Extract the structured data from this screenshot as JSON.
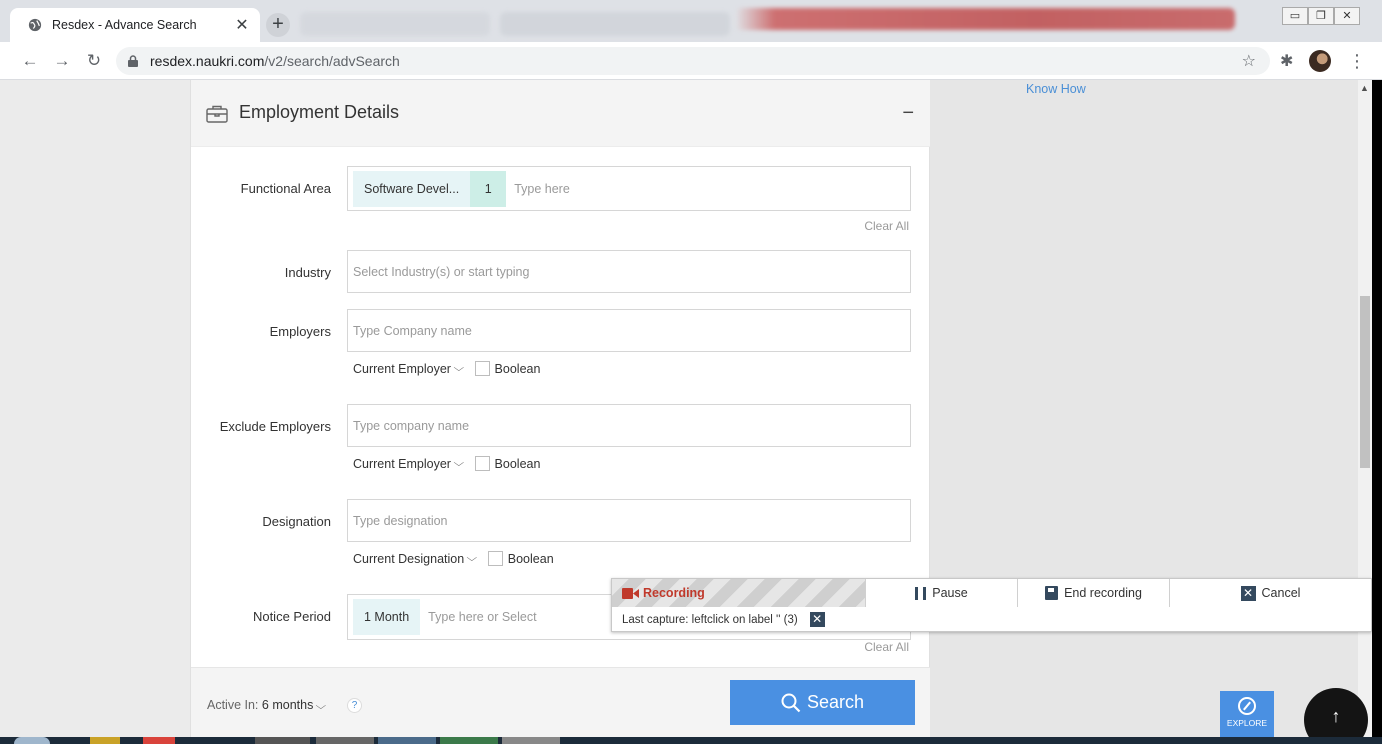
{
  "browser": {
    "tab_title": "Resdex - Advance Search",
    "url_host": "resdex.naukri.com",
    "url_path": "/v2/search/advSearch"
  },
  "side": {
    "know_how": "Know How"
  },
  "section": {
    "title": "Employment Details",
    "collapse_symbol": "−"
  },
  "functional_area": {
    "label": "Functional Area",
    "chip": "Software Devel...",
    "count": "1",
    "placeholder": "Type here",
    "clear": "Clear All"
  },
  "industry": {
    "label": "Industry",
    "placeholder": "Select Industry(s) or start typing"
  },
  "employers": {
    "label": "Employers",
    "placeholder": "Type Company name",
    "scope": "Current Employer",
    "boolean": "Boolean"
  },
  "exclude_employers": {
    "label": "Exclude Employers",
    "placeholder": "Type company name",
    "scope": "Current Employer",
    "boolean": "Boolean"
  },
  "designation": {
    "label": "Designation",
    "placeholder": "Type designation",
    "scope": "Current Designation",
    "boolean": "Boolean"
  },
  "notice_period": {
    "label": "Notice Period",
    "chip": "1 Month",
    "placeholder": "Type here or Select",
    "clear": "Clear All"
  },
  "footer": {
    "active_in_label": "Active In:",
    "active_in_value": "6 months",
    "help": "?",
    "search": "Search"
  },
  "widgets": {
    "explore": "EXPLORE"
  },
  "recorder": {
    "status": "Recording",
    "pause": "Pause",
    "end": "End recording",
    "cancel": "Cancel",
    "last_capture": "Last capture: leftclick on label '' (3)"
  },
  "colors": {
    "accent": "#4a90e2",
    "link": "#4a8fd6",
    "chip": "#e6f4f6",
    "chip_count": "#cdeee7",
    "recording": "#c0392b"
  }
}
